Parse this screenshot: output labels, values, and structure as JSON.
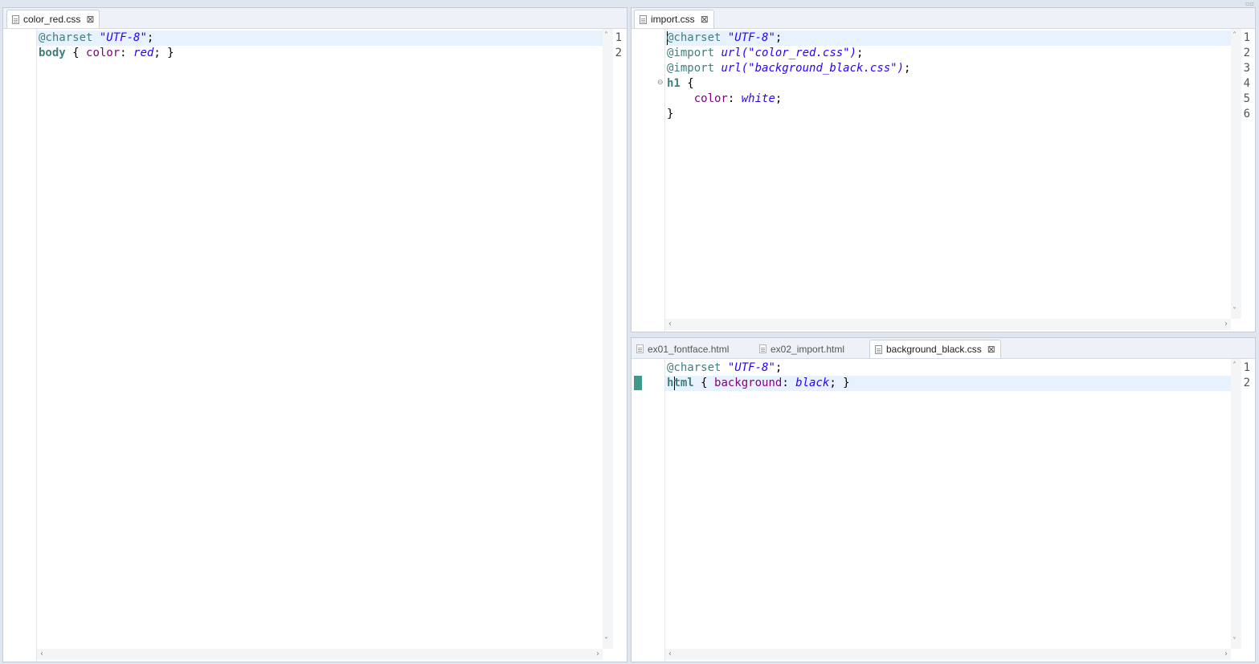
{
  "left_editor": {
    "tab": {
      "label": "color_red.css",
      "icon": "css-file-icon",
      "close_icon": "close-icon"
    },
    "lines": [
      {
        "number": "1",
        "tokens": [
          [
            "at",
            "@charset"
          ],
          [
            "plain",
            " "
          ],
          [
            "str",
            "\"UTF-8\""
          ],
          [
            "plain",
            ";"
          ]
        ]
      },
      {
        "number": "2",
        "tokens": [
          [
            "sel",
            "body"
          ],
          [
            "plain",
            " { "
          ],
          [
            "prop",
            "color"
          ],
          [
            "plain",
            ": "
          ],
          [
            "val",
            "red"
          ],
          [
            "plain",
            "; }"
          ]
        ]
      }
    ]
  },
  "top_right_editor": {
    "tab": {
      "label": "import.css",
      "icon": "css-file-icon",
      "close_icon": "close-icon"
    },
    "lines": [
      {
        "number": "1",
        "tokens": [
          [
            "at",
            "@charset"
          ],
          [
            "plain",
            " "
          ],
          [
            "str",
            "\"UTF-8\""
          ],
          [
            "plain",
            ";"
          ]
        ]
      },
      {
        "number": "2",
        "tokens": [
          [
            "at",
            "@import"
          ],
          [
            "plain",
            " "
          ],
          [
            "str",
            "url(\"color_red.css\")"
          ],
          [
            "plain",
            ";"
          ]
        ]
      },
      {
        "number": "3",
        "tokens": [
          [
            "at",
            "@import"
          ],
          [
            "plain",
            " "
          ],
          [
            "str",
            "url(\"background_black.css\")"
          ],
          [
            "plain",
            ";"
          ]
        ]
      },
      {
        "number": "4",
        "tokens": [
          [
            "sel",
            "h1"
          ],
          [
            "plain",
            " {"
          ]
        ]
      },
      {
        "number": "5",
        "tokens": [
          [
            "plain",
            "    "
          ],
          [
            "prop",
            "color"
          ],
          [
            "plain",
            ": "
          ],
          [
            "val",
            "white"
          ],
          [
            "plain",
            ";"
          ]
        ]
      },
      {
        "number": "6",
        "tokens": [
          [
            "plain",
            "}"
          ]
        ]
      }
    ],
    "fold_icon": "collapse-icon"
  },
  "bottom_right_editor": {
    "tabs": [
      {
        "label": "ex01_fontface.html",
        "active": false,
        "icon": "html-file-icon"
      },
      {
        "label": "ex02_import.html",
        "active": false,
        "icon": "html-file-icon"
      },
      {
        "label": "background_black.css",
        "active": true,
        "icon": "css-file-icon"
      }
    ],
    "close_icon": "close-icon",
    "lines": [
      {
        "number": "1",
        "tokens": [
          [
            "at",
            "@charset"
          ],
          [
            "plain",
            " "
          ],
          [
            "str",
            "\"UTF-8\""
          ],
          [
            "plain",
            ";"
          ]
        ]
      },
      {
        "number": "2",
        "tokens": [
          [
            "sel",
            "html"
          ],
          [
            "plain",
            " { "
          ],
          [
            "prop",
            "background"
          ],
          [
            "plain",
            ": "
          ],
          [
            "val",
            "black"
          ],
          [
            "plain",
            "; }"
          ]
        ]
      }
    ]
  },
  "colors": {
    "at_rule": "#3f7f7f",
    "string": "#2a00ff",
    "selector": "#3f7f7f",
    "property": "#7f007f",
    "current_line": "#e8f2fe",
    "change_marker": "#3d9a8a"
  }
}
